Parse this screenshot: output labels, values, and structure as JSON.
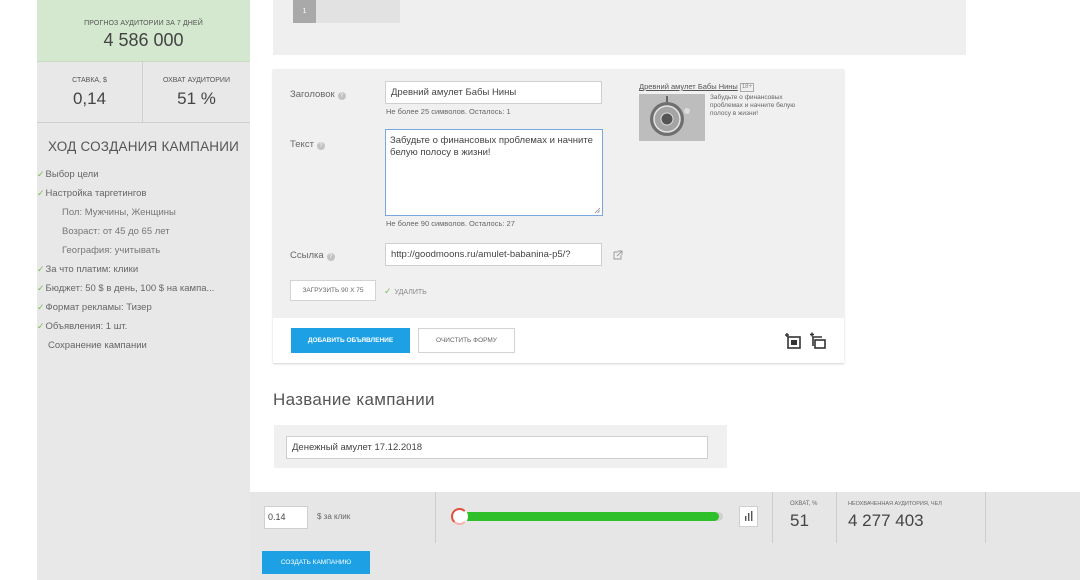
{
  "sidebar": {
    "forecast": {
      "caption": "ПРОГНОЗ АУДИТОРИИ ЗА 7 ДНЕЙ",
      "value": "4 586 000"
    },
    "bid": {
      "caption": "СТАВКА, $",
      "value": "0,14"
    },
    "reach": {
      "caption": "ОХВАТ АУДИТОРИИ",
      "value": "51 %"
    },
    "progress_title": "ХОД СОЗДАНИЯ КАМПАНИИ",
    "steps": [
      {
        "label": "Выбор цели",
        "done": true,
        "sub": false
      },
      {
        "label": "Настройка таргетингов",
        "done": true,
        "sub": false
      },
      {
        "label": "Пол: Мужчины, Женщины",
        "done": false,
        "sub": true
      },
      {
        "label": "Возраст: от 45 до 65 лет",
        "done": false,
        "sub": true
      },
      {
        "label": "География: учитывать",
        "done": false,
        "sub": true
      },
      {
        "label": "За что платим: клики",
        "done": true,
        "sub": false
      },
      {
        "label": "Бюджет: 50 $ в день, 100 $ на кампа...",
        "done": true,
        "sub": false
      },
      {
        "label": "Формат рекламы: Тизер",
        "done": true,
        "sub": false
      },
      {
        "label": "Объявления: 1 шт.",
        "done": true,
        "sub": false
      },
      {
        "label": "Сохранение кампании",
        "done": false,
        "sub": false
      }
    ]
  },
  "pager": {
    "current": "1"
  },
  "ad_form": {
    "headline_label": "Заголовок",
    "headline_value": "Древний амулет Бабы Нины",
    "headline_hint": "Не более 25 символов. Осталось: 1",
    "text_label": "Текст",
    "text_value": "Забудьте о финансовых проблемах и начните белую полосу в жизни!",
    "text_hint": "Не более 90 символов. Осталось: 27",
    "link_label": "Ссылка",
    "link_value": "http://goodmoons.ru/amulet-babanina-p5/?",
    "upload_button": "ЗАГРУЗИТЬ 90 Х 75",
    "delete_label": "УДАЛИТЬ",
    "add_button": "ДОБАВИТЬ ОБЪЯВЛЕНИЕ",
    "clear_button": "ОЧИСТИТЬ ФОРМУ",
    "help_glyph": "?"
  },
  "preview": {
    "title": "Древний амулет Бабы Нины",
    "age": "18+",
    "text": "Забудьте о финансовых проблемах и начните белую полосу в жизни!"
  },
  "campaign": {
    "title": "Название кампании",
    "name_value": "Денежный амулет 17.12.2018"
  },
  "bottom_bar": {
    "bid_value": "0.14",
    "bid_unit": "$ за клик",
    "slider_fraction": 0.985,
    "reach_caption": "ОХВАТ, %",
    "reach_value": "51",
    "unreached_caption": "НЕОХВАЧЕННАЯ АУДИТОРИЯ, ЧЕЛ",
    "unreached_value": "4 277 403",
    "create_button": "СОЗДАТЬ КАМПАНИЮ"
  },
  "colors": {
    "accent": "#1da1e4",
    "forecast_bg": "#d4e7cf",
    "check": "#7cbb52",
    "slider_fill": "#2fbf2a",
    "slider_knob": "#e0503c"
  },
  "icons": [
    "help-icon",
    "check-icon",
    "external-link-icon",
    "add-teaser-icon",
    "copy-teaser-icon",
    "bar-chart-icon",
    "resize-handle-icon"
  ]
}
